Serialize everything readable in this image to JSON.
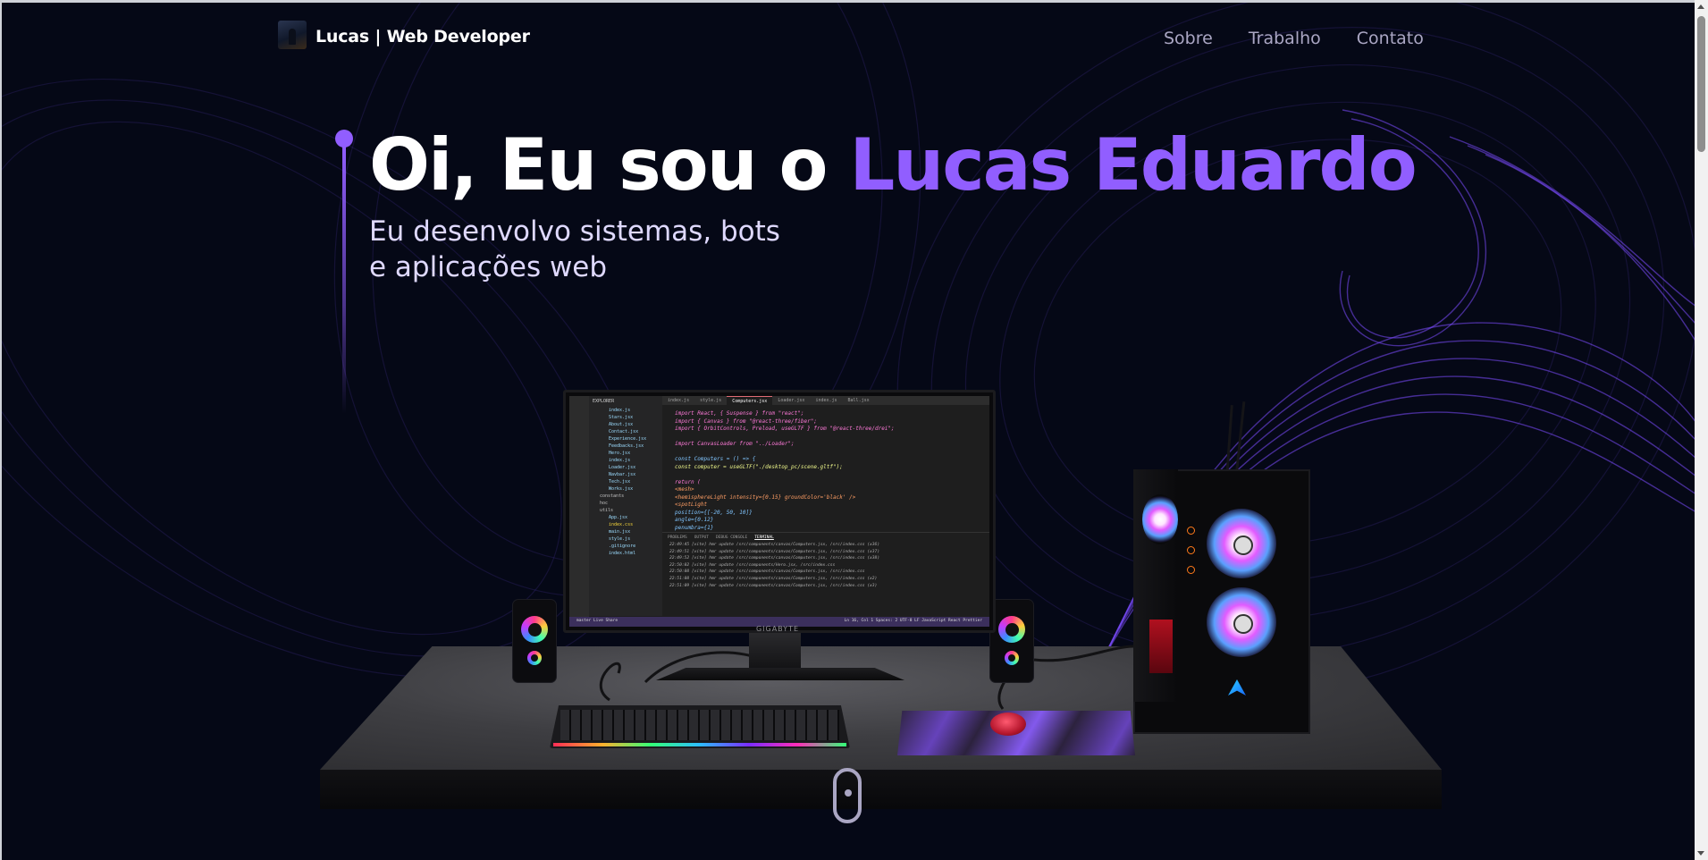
{
  "navbar": {
    "logo_name": "Lucas",
    "logo_role": " | Web Developer",
    "links": [
      {
        "label": "Sobre"
      },
      {
        "label": "Trabalho"
      },
      {
        "label": "Contato"
      }
    ]
  },
  "hero": {
    "greeting": "Oi, Eu sou o ",
    "name": "Lucas Eduardo",
    "subtitle_line1": "Eu desenvolvo sistemas, bots",
    "subtitle_line2": "e aplicações web"
  },
  "scene": {
    "monitor_brand": "GIGABYTE",
    "editor": {
      "tabs": [
        "index.js",
        "style.js",
        "Computers.jsx",
        "Loader.jsx",
        "index.js",
        "Ball.jsx"
      ],
      "explorer_title": "EXPLORER",
      "files": [
        "index.js",
        "Stars.jsx",
        "About.jsx",
        "Contact.jsx",
        "Experience.jsx",
        "Feedbacks.jsx",
        "Hero.jsx",
        "index.js",
        "Loader.jsx",
        "Navbar.jsx",
        "Tech.jsx",
        "Works.jsx",
        "constants",
        "hoc",
        "utils",
        "App.jsx",
        "index.css",
        "main.jsx",
        "style.js",
        ".gitignore",
        "index.html"
      ],
      "code_lines": [
        "import React, { Suspense } from \"react\";",
        "import { Canvas } from \"@react-three/fiber\";",
        "import { OrbitControls, Preload, useGLTF } from \"@react-three/drei\";",
        "",
        "import CanvasLoader from \"../Loader\";",
        "",
        "const Computers = () => {",
        "  const computer = useGLTF(\"./desktop_pc/scene.gltf\");",
        "",
        "  return (",
        "    <mesh>",
        "      <hemisphereLight intensity={0.15} groundColor='black' />",
        "      <spotLight",
        "        position={[-20, 50, 10]}",
        "        angle={0.12}",
        "        penumbra={1}"
      ],
      "panel_tabs": [
        "PROBLEMS",
        "OUTPUT",
        "DEBUG CONSOLE",
        "TERMINAL"
      ],
      "terminal_lines": [
        "22:49:45 [vite] hmr update /src/components/canvas/Computers.jsx, /src/index.css (x36)",
        "22:49:51 [vite] hmr update /src/components/canvas/Computers.jsx, /src/index.css (x37)",
        "22:49:52 [vite] hmr update /src/components/canvas/Computers.jsx, /src/index.css (x38)",
        "22:50:02 [vite] hmr update /src/components/Hero.jsx, /src/index.css",
        "22:50:08 [vite] hmr update /src/components/canvas/Computers.jsx, /src/index.css",
        "22:51:08 [vite] hmr update /src/components/canvas/Computers.jsx, /src/index.css (x2)",
        "22:51:09 [vite] hmr update /src/components/canvas/Computers.jsx, /src/index.css (x3)"
      ],
      "status_left": "master   Live Share",
      "status_right": "Ln 16, Col 1   Spaces: 2   UTF-8   LF   JavaScript React   Prettier"
    }
  },
  "colors": {
    "background": "#050816",
    "accent": "#915eff",
    "nav_text": "#aaa6c3",
    "subtitle_text": "#dfd9ff"
  },
  "icons": [
    "logo-avatar",
    "scroll-down-indicator"
  ]
}
